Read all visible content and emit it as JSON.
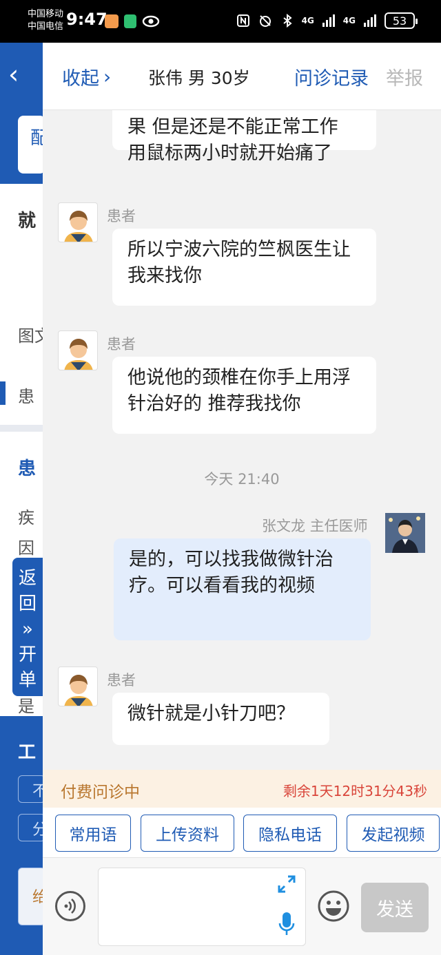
{
  "status_bar": {
    "carrier_1": "中国移动",
    "carrier_2": "中国电信",
    "time": "9:47",
    "network_1": "4G",
    "network_2": "4G",
    "battery": "53"
  },
  "underlay": {
    "card_char": "配",
    "heading_char": "就",
    "row1_char": "图文",
    "row2_char": "患",
    "row3_char": "患",
    "row4_char": "疾",
    "row5_char": "因",
    "row6_char": "是",
    "work_char": "工",
    "bottom_btn1": "不",
    "bottom_btn2": "分",
    "bottom_card_char": "给",
    "float_button": [
      "返",
      "回",
      "»",
      "开",
      "单"
    ]
  },
  "header": {
    "collapse_label": "收起",
    "patient_title": "张伟 男 30岁",
    "records_label": "问诊记录",
    "report_label": "举报"
  },
  "messages": {
    "m1_line1": "果 但是还是不能正常工作",
    "m1_line2": "用鼠标两小时就开始痛了",
    "m2_sender": "患者",
    "m2_text": "所以宁波六院的竺枫医生让我来找你",
    "m3_sender": "患者",
    "m3_text": "他说他的颈椎在你手上用浮针治好的 推荐我找你",
    "timestamp": "今天 21:40",
    "m4_sender": "张文龙 主任医师",
    "m4_text": "是的，可以找我做微针治疗。可以看看我的视频",
    "m5_sender": "患者",
    "m5_text": "微针就是小针刀吧？"
  },
  "payment": {
    "status": "付费问诊中",
    "remaining": "剩余1天12时31分43秒"
  },
  "quick_actions": {
    "phrases": "常用语",
    "upload": "上传资料",
    "private_call": "隐私电话",
    "video": "发起视频"
  },
  "composer": {
    "send_label": "发送"
  },
  "colors": {
    "brand_blue": "#1f5bb4",
    "pay_banner": "#fcf1e3",
    "remaining_red": "#d9453a",
    "doctor_bubble": "#e3edfc"
  }
}
